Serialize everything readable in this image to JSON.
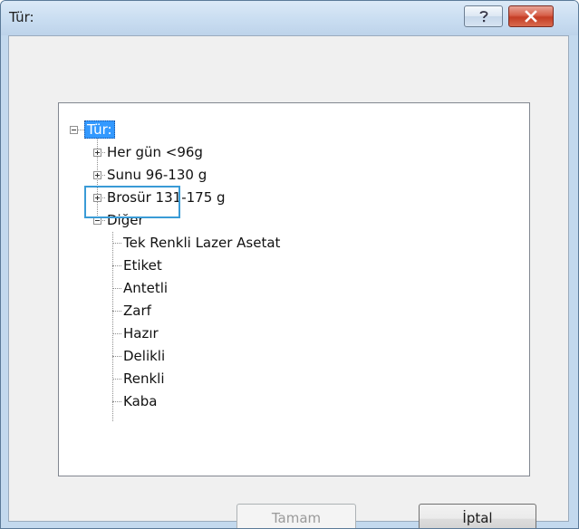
{
  "window": {
    "title": "Tür:",
    "help_icon": "question-mark-icon",
    "close_icon": "close-x-icon",
    "colors": {
      "title_bar": "#c9ddf1",
      "close_button": "#c43d25",
      "selection": "#3399ff",
      "highlight_box": "#3a9bd6"
    }
  },
  "tree": {
    "root": {
      "label": "Tür:",
      "expanded": true,
      "selected": true
    },
    "items": [
      {
        "label": "Her gün <96g",
        "expanded": false
      },
      {
        "label": "Sunu 96-130 g",
        "expanded": false
      },
      {
        "label": "Brosür 131-175 g",
        "expanded": false
      },
      {
        "label": "Diğer",
        "expanded": true,
        "children": [
          {
            "label": "Tek Renkli Lazer Asetat"
          },
          {
            "label": "Etiket"
          },
          {
            "label": "Antetli"
          },
          {
            "label": "Zarf"
          },
          {
            "label": "Hazır"
          },
          {
            "label": "Delikli"
          },
          {
            "label": "Renkli"
          },
          {
            "label": "Kaba"
          }
        ]
      }
    ]
  },
  "buttons": {
    "ok_label": "Tamam",
    "ok_enabled": false,
    "cancel_label": "İptal"
  }
}
